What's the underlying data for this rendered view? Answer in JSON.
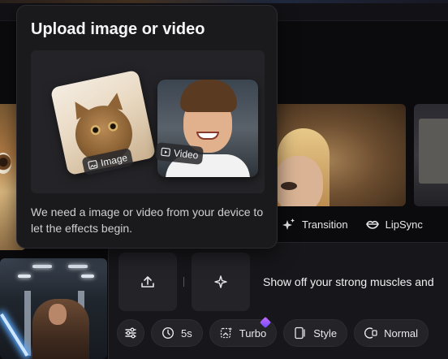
{
  "popover": {
    "title": "Upload image or video",
    "image_tag": "Image",
    "video_tag": "Video",
    "description": "We need a image or video from your device to let the effects begin."
  },
  "effects": {
    "items": [
      {
        "label": "Transition",
        "icon": "sparkle-transition-icon"
      },
      {
        "label": "LipSync",
        "icon": "lips-icon"
      }
    ]
  },
  "generator": {
    "prompt": "Show off your strong muscles and",
    "toolbar": {
      "duration": "5s",
      "mode": "Turbo",
      "style": "Style",
      "quality": "Normal"
    }
  },
  "colors": {
    "background": "#0b0b0d",
    "panel": "#17171b",
    "popover": "#1a1a1d",
    "gem_accent": "#a85bff"
  }
}
